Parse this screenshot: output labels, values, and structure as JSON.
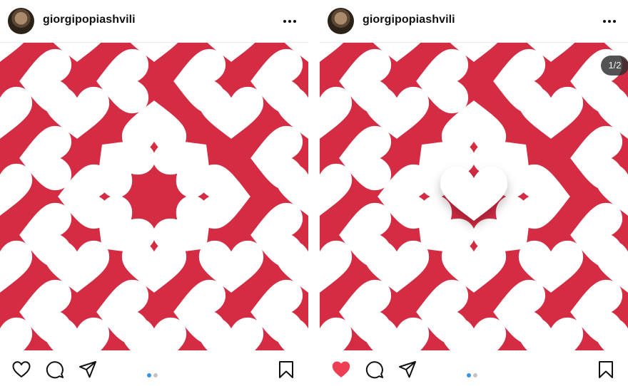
{
  "posts": [
    {
      "username": "giorgipopiashvili",
      "liked": false,
      "carousel": {
        "current": 1,
        "total": 2
      }
    },
    {
      "username": "giorgipopiashvili",
      "liked": true,
      "carousel": {
        "current": 1,
        "total": 2,
        "counter_label": "1/2"
      }
    }
  ],
  "colors": {
    "pattern_red": "#d32c43",
    "like_red": "#ee3e54",
    "active_dot": "#3797f0",
    "inactive_dot": "#c4c4c4"
  },
  "icons": {
    "menu": "more-horizontal-icon",
    "like": "heart-icon",
    "comment": "comment-icon",
    "share": "paper-plane-icon",
    "save": "bookmark-icon"
  }
}
